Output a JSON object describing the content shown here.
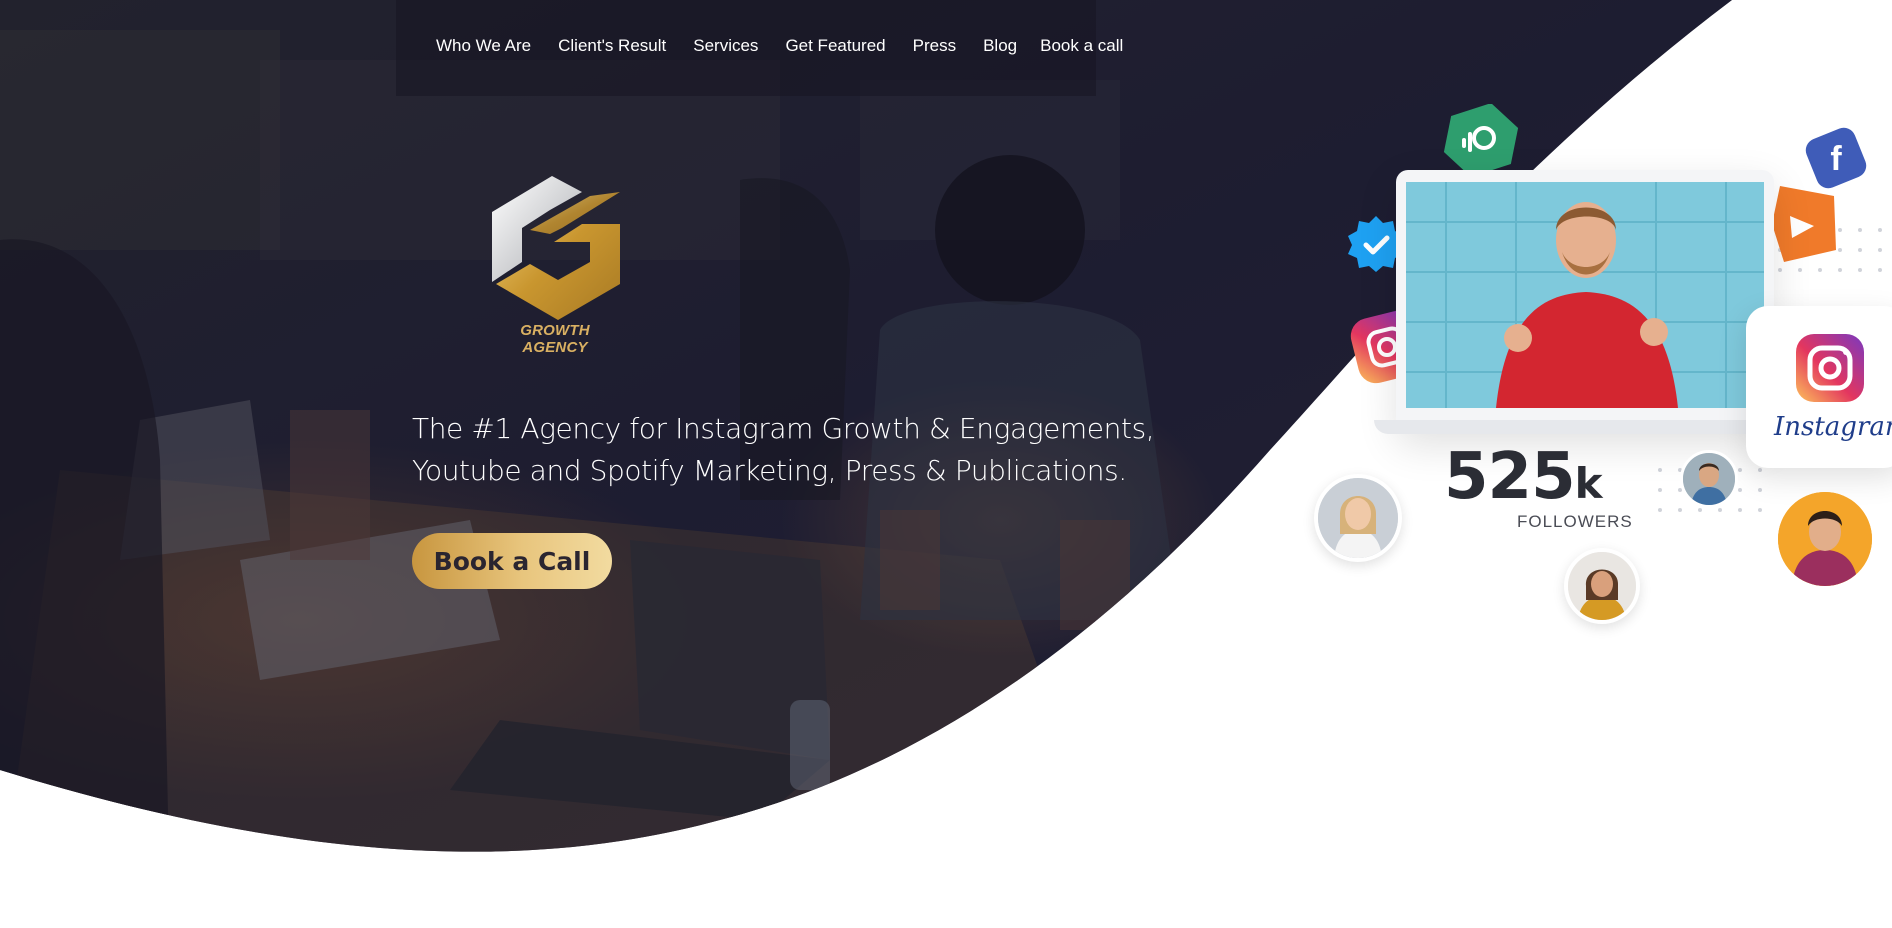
{
  "nav": {
    "items": [
      "Who We Are",
      "Client's Result",
      "Services",
      "Get Featured",
      "Press",
      "Blog",
      "Book a call"
    ]
  },
  "logo": {
    "text": "GROWTH AGENCY"
  },
  "hero": {
    "headline": "The #1 Agency for Instagram Growth & Engagements, Youtube and Spotify Marketing, Press & Publications.",
    "cta_label": "Book a Call"
  },
  "showcase": {
    "followers_number": "525",
    "followers_suffix": "k",
    "followers_label": "FOLLOWERS",
    "instagram_word": "Instagram"
  },
  "colors": {
    "accent_gold": "#d4a44c",
    "hero_dark": "#1a1a2e",
    "nav_text": "#ffffff"
  },
  "icons": [
    "facebook-icon",
    "instagram-icon",
    "verified-badge-icon",
    "podcast-icon",
    "play-icon"
  ]
}
